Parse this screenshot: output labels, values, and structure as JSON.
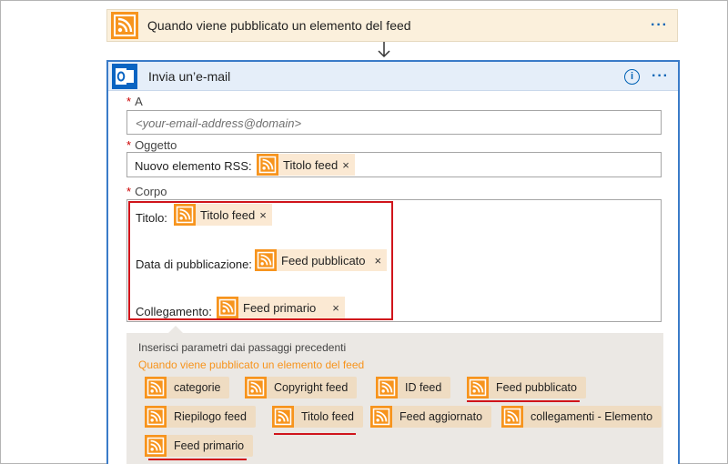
{
  "trigger": {
    "title": "Quando viene pubblicato un elemento del feed",
    "more": "···",
    "icon": "rss-icon"
  },
  "action": {
    "title": "Invia un’e-mail",
    "info": "i",
    "more": "···",
    "icon": "outlook-icon"
  },
  "fields": {
    "required_mark": "*",
    "to_label": "A",
    "to_placeholder": "<your-email-address@domain>",
    "subject_label": "Oggetto",
    "subject_prefix": "Nuovo elemento RSS:",
    "subject_token": "Titolo feed",
    "body_label": "Corpo",
    "body_lines": [
      {
        "label": "Titolo:",
        "token": "Titolo feed"
      },
      {
        "label": "Data di pubblicazione:",
        "token": "Feed pubblicato"
      },
      {
        "label": "Collegamento:",
        "token": "Feed primario"
      }
    ],
    "remove": "×"
  },
  "params": {
    "hint": "Inserisci parametri dai passaggi precedenti",
    "trigger_name": "Quando viene pubblicato un elemento del feed",
    "chips": [
      "categorie",
      "Copyright feed",
      "ID feed",
      "Feed pubblicato",
      "Riepilogo feed",
      "Titolo feed",
      "Feed aggiornato",
      "collegamenti - Elemento",
      "Feed primario"
    ]
  },
  "colors": {
    "rss_orange": "#f7941d",
    "highlight_red": "#d0141b",
    "header_blue": "#e5eef9",
    "outlook_blue": "#0a64c2"
  }
}
